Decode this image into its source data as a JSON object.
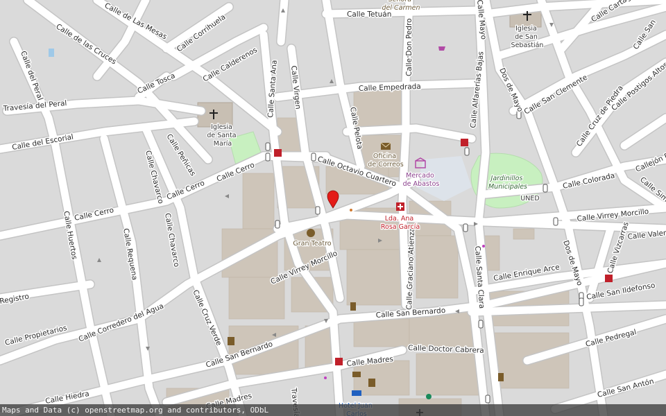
{
  "map": {
    "colors": {
      "background": "#d9d9d9",
      "road": "#ffffff",
      "road_casing": "#c6c6c6",
      "building": "#cfc6ba",
      "park": "#c8f0c0",
      "garden": "#d8f5d0",
      "marker": "#e41b17",
      "pharmacy": "#c0202a"
    },
    "street_labels": [
      "Calle de Las Mesas",
      "Calle de las Cruces",
      "Calle Corrihuela",
      "Calle Calderenos",
      "Calle Tosca",
      "Calle del Peral",
      "Travesía del Peral",
      "Calle del Escorial",
      "Calle Santa Ana",
      "Calle Virgen",
      "Calle Tetuán",
      "Calle Don Pedro",
      "Calle Empedrada",
      "Calle Pelota",
      "Calle Octavio Cuartero",
      "Calle Cerro",
      "Calle Cerro",
      "Calle Cerro",
      "Calle Peñicas",
      "Calle Chavarco",
      "Calle Chavarco",
      "Calle Huertos",
      "Calle Requena",
      "Calle Corredero del Agua",
      "Calle Virrey Morcillo",
      "Calle Graciano Atienza",
      "Calle San Bernardo",
      "Calle San Bernardo",
      "Calle Cruz Verde",
      "Calle Propietarios",
      "Registro",
      "Calle Madres",
      "Calle Doctor Cabrera",
      "Calle Santa Clara",
      "Calle Alfarerías Bajas",
      "Dos de Mayo",
      "Calle San Clemente",
      "Calle Cruz de Piedra",
      "Calle Postigos Altos",
      "Calle Colorada",
      "Calle Virrey Morcillo",
      "Calle Enrique Arce",
      "Calle San Ildefonso",
      "Dos de Mayo",
      "Calle Vizcarras",
      "Calle Valera",
      "Calle Pedregal",
      "Calle San Antón",
      "Calle Hiedra",
      "Calle Madres",
      "Travesía",
      "Calle Cartagena",
      "Calle San",
      "Calle Sima",
      "Callejón R",
      "Calle Mayo"
    ],
    "poi_labels": {
      "church_santa_maria": "Iglesia de Santa María",
      "church_san_sebastian": "Iglesia de San Sebastián",
      "post_office": "Oficina de Correos",
      "market": "Mercado de Abastos",
      "pharmacy": "Lda. Ana Rosa García",
      "theatre": "Gran Teatro",
      "gardens": "Jardinillos Municipales",
      "uned": "UNED",
      "hotel": "Hotel Juan Carlos",
      "carmen": "Señora del Carmen"
    },
    "icons": {
      "church": "cross-icon",
      "post": "envelope-icon",
      "market": "market-icon",
      "pharmacy": "pharmacy-cross-icon",
      "theatre": "theatre-masks-icon",
      "marker": "location-pin-icon",
      "shop": "shopping-cart-icon",
      "hotel": "bed-icon",
      "monument": "monument-icon"
    },
    "attribution": "Maps and Data (c) openstreetmap.org and contributors, ODbL"
  }
}
